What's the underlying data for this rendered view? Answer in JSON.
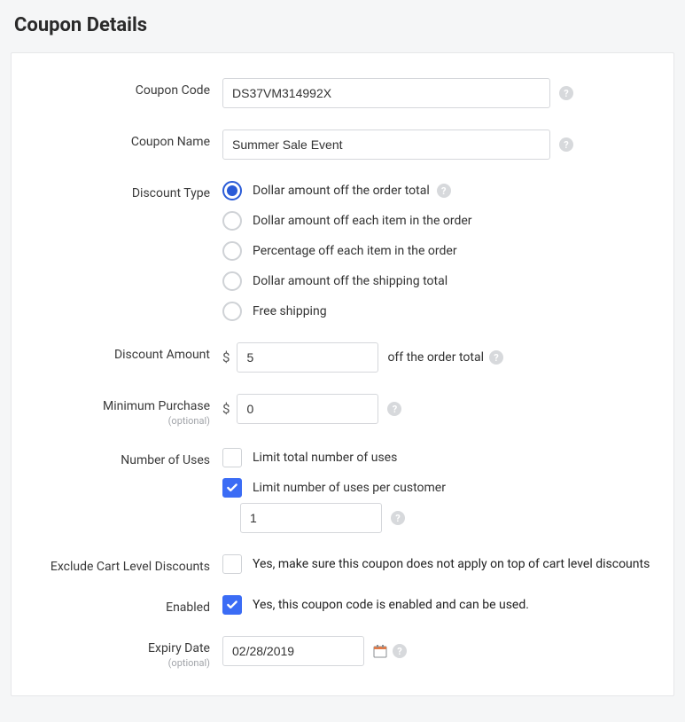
{
  "page_title": "Coupon Details",
  "labels": {
    "coupon_code": "Coupon Code",
    "coupon_name": "Coupon Name",
    "discount_type": "Discount Type",
    "discount_amount": "Discount Amount",
    "minimum_purchase": "Minimum Purchase",
    "number_of_uses": "Number of Uses",
    "exclude_cart": "Exclude Cart Level Discounts",
    "enabled": "Enabled",
    "expiry_date": "Expiry Date",
    "optional": "(optional)"
  },
  "values": {
    "coupon_code": "DS37VM314992X",
    "coupon_name": "Summer Sale Event",
    "discount_amount": "5",
    "minimum_purchase": "0",
    "per_customer_limit": "1",
    "expiry_date": "02/28/2019"
  },
  "discount_type": {
    "selected_index": 0,
    "options": [
      "Dollar amount off the order total",
      "Dollar amount off each item in the order",
      "Percentage off each item in the order",
      "Dollar amount off the shipping total",
      "Free shipping"
    ]
  },
  "strings": {
    "currency": "$",
    "off_order_total": "off the order total",
    "limit_total": "Limit total number of uses",
    "limit_per_customer": "Limit number of uses per customer",
    "exclude_text": "Yes, make sure this coupon does not apply on top of cart level discounts",
    "enabled_text": "Yes, this coupon code is enabled and can be used."
  },
  "checkboxes": {
    "limit_total": false,
    "limit_per_customer": true,
    "exclude_cart": false,
    "enabled": true
  }
}
